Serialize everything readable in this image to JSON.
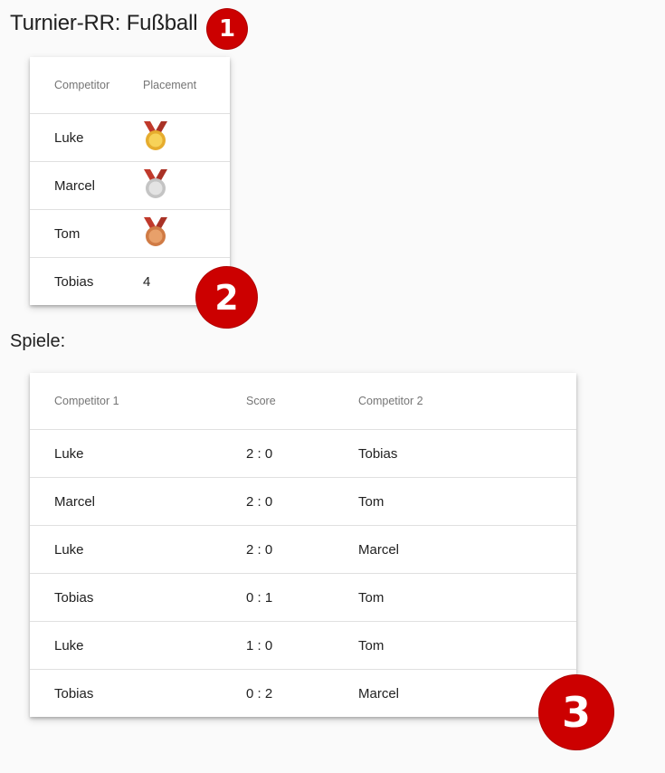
{
  "page": {
    "title": "Turnier-RR: Fußball",
    "games_heading": "Spiele:"
  },
  "standings": {
    "headers": {
      "competitor": "Competitor",
      "placement": "Placement"
    },
    "rows": [
      {
        "competitor": "Luke",
        "placement": "1",
        "medal": "gold-medal-icon"
      },
      {
        "competitor": "Marcel",
        "placement": "2",
        "medal": "silver-medal-icon"
      },
      {
        "competitor": "Tom",
        "placement": "3",
        "medal": "bronze-medal-icon"
      },
      {
        "competitor": "Tobias",
        "placement": "4"
      }
    ]
  },
  "games": {
    "headers": {
      "competitor1": "Competitor 1",
      "score": "Score",
      "competitor2": "Competitor 2"
    },
    "rows": [
      {
        "competitor1": "Luke",
        "score": "2 : 0",
        "competitor2": "Tobias"
      },
      {
        "competitor1": "Marcel",
        "score": "2 : 0",
        "competitor2": "Tom"
      },
      {
        "competitor1": "Luke",
        "score": "2 : 0",
        "competitor2": "Marcel"
      },
      {
        "competitor1": "Tobias",
        "score": "0 : 1",
        "competitor2": "Tom"
      },
      {
        "competitor1": "Luke",
        "score": "1 : 0",
        "competitor2": "Tom"
      },
      {
        "competitor1": "Tobias",
        "score": "0 : 2",
        "competitor2": "Marcel"
      }
    ]
  },
  "annotations": {
    "badge1": "1",
    "badge2": "2",
    "badge3": "3"
  },
  "colors": {
    "background": "#fafafa",
    "badge": "#cc0000",
    "ribbon": "#c0392b",
    "gold": "#f0c040",
    "silver": "#d6d6d6",
    "bronze": "#e0935a"
  }
}
